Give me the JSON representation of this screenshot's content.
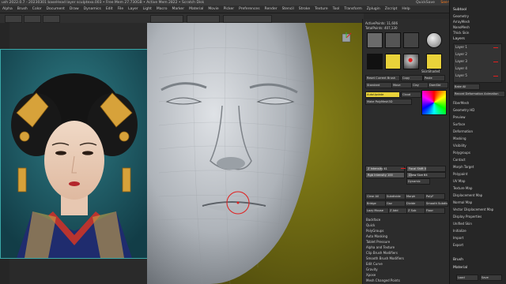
{
  "titlebar": {
    "text": "ush 2022.0.7 - 20230301 baseHead layer sculptexo.003   • Free Mem 27.730GB • Active Mem 2822 • Scratch Disk",
    "right": {
      "item1": "QuickSave",
      "item2": "See-through  0",
      "item3": "Default2ScriptS"
    }
  },
  "menubar": {
    "items": [
      "Alpha",
      "Brush",
      "Color",
      "Document",
      "Draw",
      "Dynamics",
      "Edit",
      "File",
      "Layer",
      "Light",
      "Macro",
      "Marker",
      "Material",
      "Movie",
      "Picker",
      "Preferences",
      "Render",
      "Stencil",
      "Stroke",
      "Texture",
      "Tool",
      "Transform",
      "Zplugin",
      "Zscript",
      "Help"
    ]
  },
  "accent": {
    "orange": "#ff7a1a",
    "yellow": "#e9d23a",
    "red": "#e02020",
    "teal": "#3aa7a7"
  },
  "panelA": {
    "stats": [
      "ActivePoints: 11,606",
      "TotalPoints: 407,130"
    ],
    "thumb_label": "SkinShade4",
    "brush_row_labels": [
      "Standard",
      "Move",
      "Clay",
      "DamStd"
    ],
    "reset_label": "Reset Current Brush",
    "copy_paste": [
      "Copy",
      "Paste"
    ],
    "mesh_labels": [
      "AutoUpdate",
      "Cloud",
      "Make PolyMesh3D"
    ],
    "sliders": [
      "Z Intensity 41",
      "Rgb Intensity 100",
      "Focal Shift 0",
      "Draw Size 64",
      "Dynamic"
    ],
    "tools": [
      "Clear All",
      "Subdivide",
      "Morph",
      "PolyF",
      "Bridge",
      "Goz",
      "Divide",
      "Smooth Subdiv",
      "Lazy Mouse",
      "Z Add",
      "Z Sub",
      "Floor"
    ],
    "list_rows": [
      "Backface",
      "Quick",
      "PolyGroups",
      "Auto Masking",
      "Tablet Pressure",
      "Alpha and Texture",
      "Clip Brush Modifiers",
      "Smooth Brush Modifiers",
      "Edit Curve",
      "Gravity",
      "Xpose",
      "Mesh Changed Points"
    ]
  },
  "panelB": {
    "top_header": "Subtool",
    "top_items": [
      "Geometry",
      "ArrayMesh",
      "NanoMesh",
      "Thick Skin"
    ],
    "layers_header": "Layers",
    "layer_items": [
      "Layer 1",
      "Layer 2",
      "Layer 3",
      "Layer 4",
      "Layer 5"
    ],
    "bake_label": "Bake All",
    "record_label": "Record Deformation Animation",
    "list_items": [
      "FiberMesh",
      "Geometry HD",
      "Preview",
      "Surface",
      "Deformation",
      "Masking",
      "Visibility",
      "Polygroups",
      "Contact",
      "Morph Target",
      "Polypaint",
      "UV Map",
      "Texture Map",
      "Displacement Map",
      "Normal Map",
      "Vector Displacement Map",
      "Display Properties",
      "Unified Skin",
      "Initialize",
      "Import",
      "Export"
    ],
    "bottom_brush": "Brush",
    "bottom_material": "Material",
    "bottom_buttons": [
      "Load",
      "Save"
    ]
  }
}
